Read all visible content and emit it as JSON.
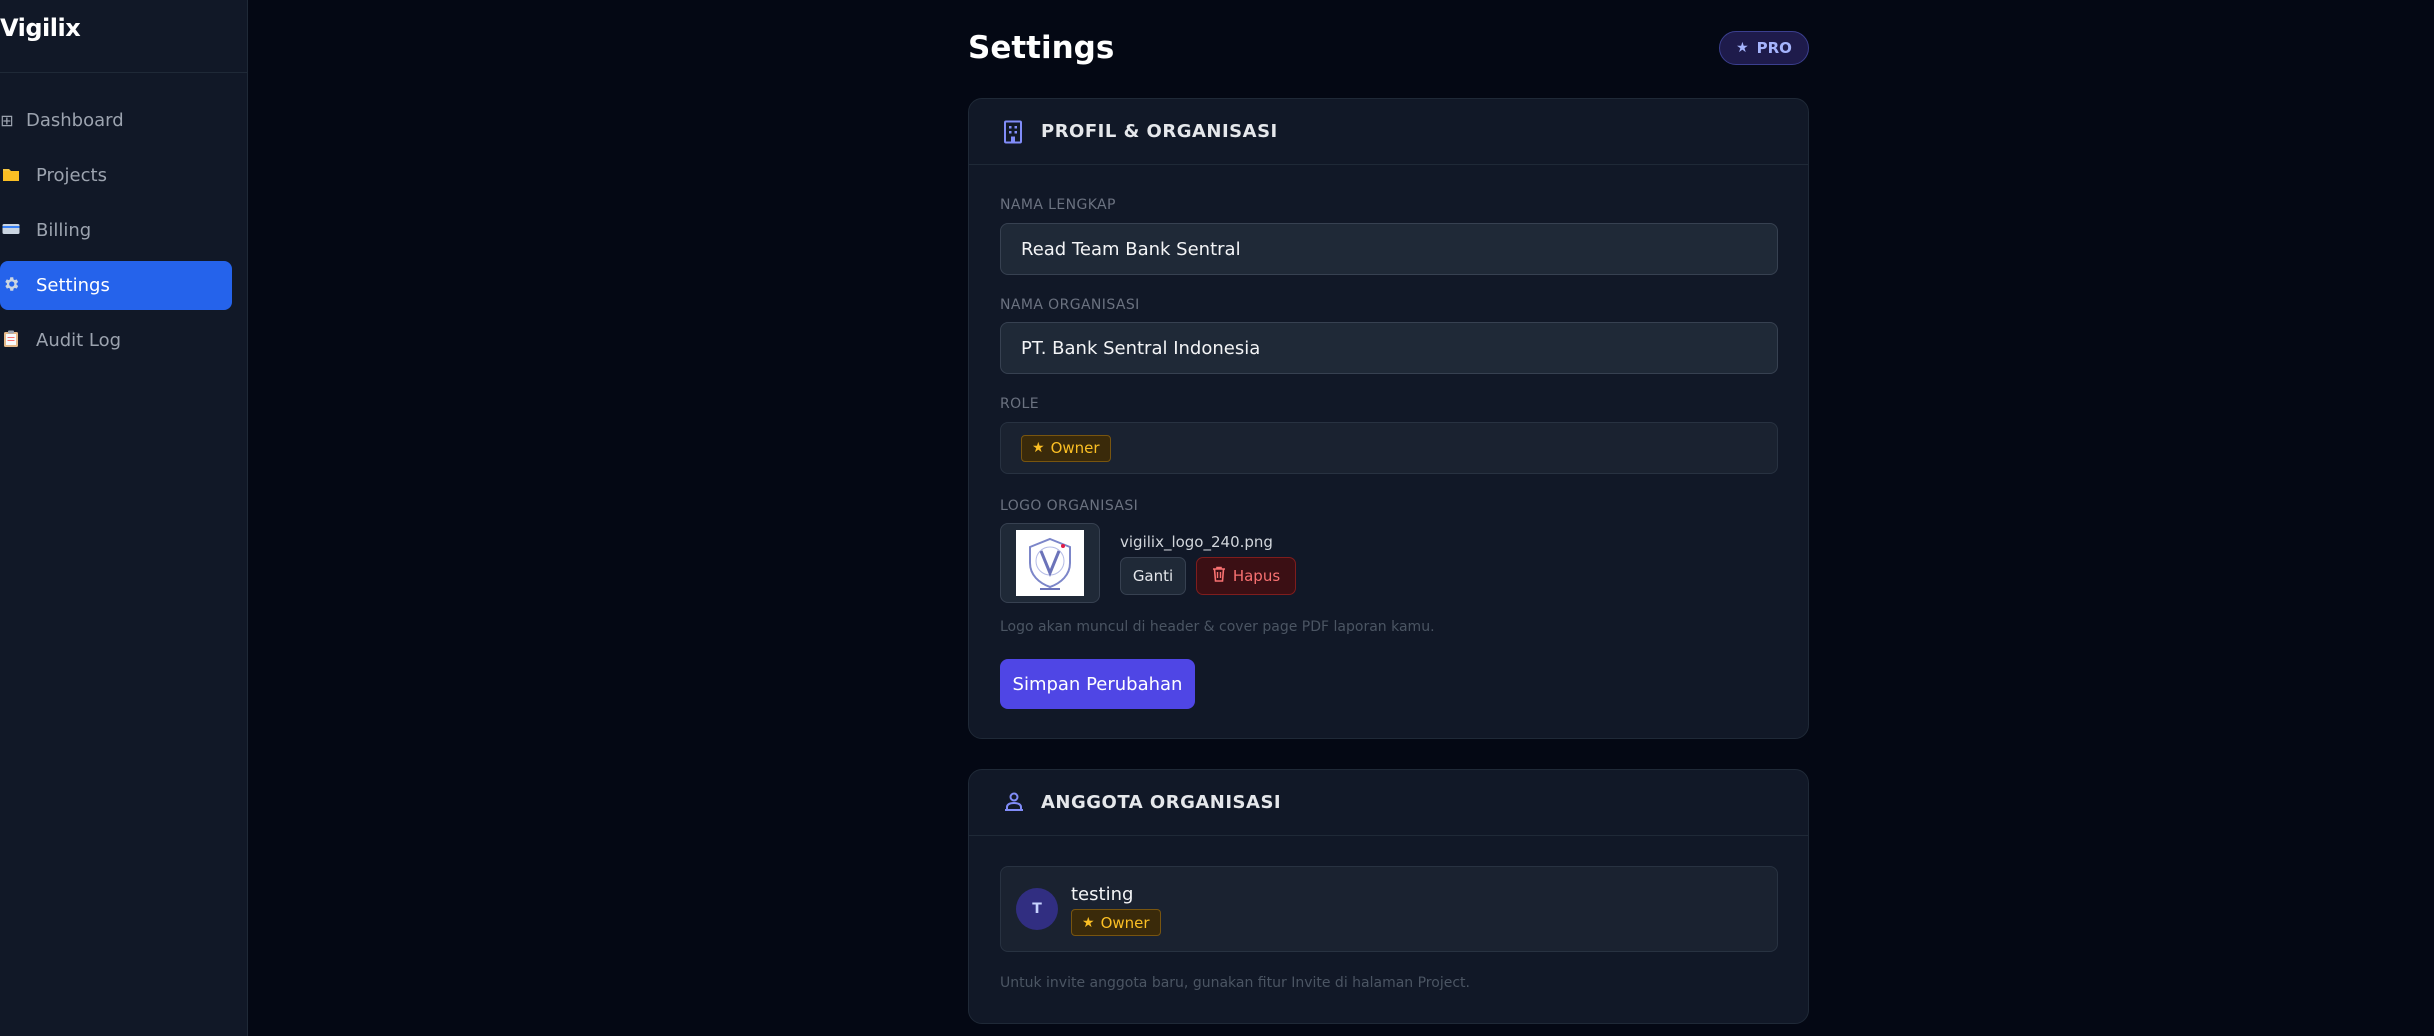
{
  "sidebar": {
    "brand": "Vigilix",
    "items": [
      {
        "label": "Dashboard",
        "icon": "grid-icon",
        "active": false
      },
      {
        "label": "Projects",
        "icon": "folder-icon",
        "active": false
      },
      {
        "label": "Billing",
        "icon": "credit-card-icon",
        "active": false
      },
      {
        "label": "Settings",
        "icon": "gear-icon",
        "active": true
      },
      {
        "label": "Audit Log",
        "icon": "clipboard-icon",
        "active": false
      }
    ]
  },
  "header": {
    "title": "Settings",
    "plan_badge": "PRO"
  },
  "profile": {
    "title": "PROFIL & ORGANISASI",
    "full_name_label": "NAMA LENGKAP",
    "full_name_value": "Read Team Bank Sentral",
    "org_name_label": "NAMA ORGANISASI",
    "org_name_value": "PT. Bank Sentral Indonesia",
    "role_label": "ROLE",
    "role_value": "Owner",
    "logo_label": "LOGO ORGANISASI",
    "logo_file": "vigilix_logo_240.png",
    "change_label": "Ganti",
    "delete_label": "Hapus",
    "logo_hint": "Logo akan muncul di header & cover page PDF laporan kamu.",
    "save_label": "Simpan Perubahan"
  },
  "members": {
    "title": "ANGGOTA ORGANISASI",
    "list": [
      {
        "initial": "T",
        "name": "testing",
        "role": "Owner"
      }
    ],
    "hint": "Untuk invite anggota baru, gunakan fitur Invite di halaman Project."
  },
  "colors": {
    "accent": "#4f46e5",
    "active_nav": "#2563eb",
    "owner_badge": "#fbbf24",
    "danger": "#f87171"
  }
}
